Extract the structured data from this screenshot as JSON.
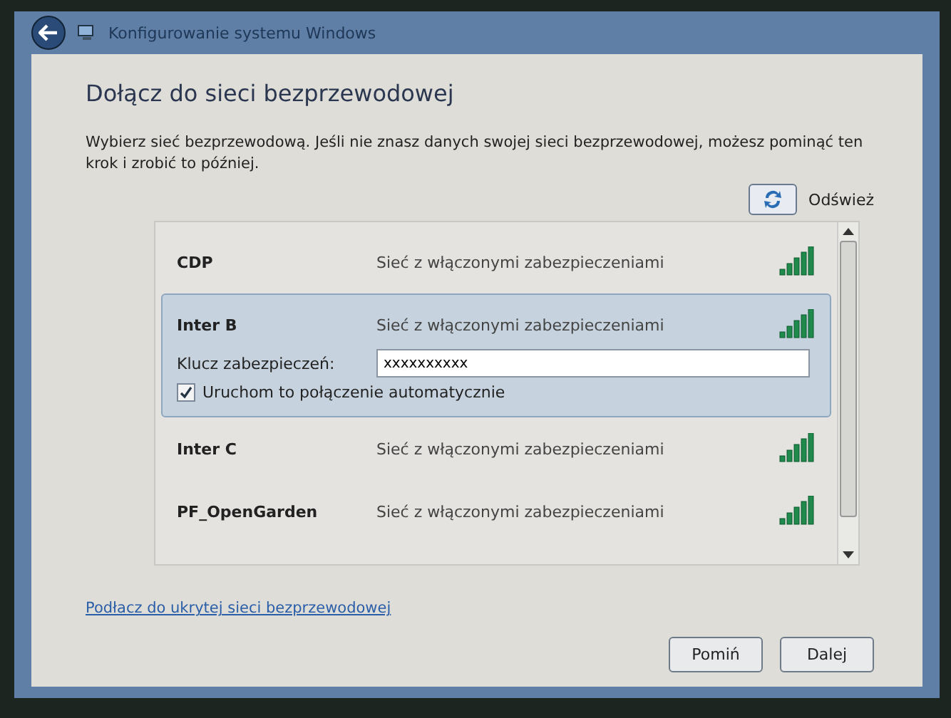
{
  "window": {
    "title": "Konfigurowanie systemu Windows"
  },
  "heading": "Dołącz do sieci bezprzewodowej",
  "description": "Wybierz sieć bezprzewodową. Jeśli nie znasz danych swojej sieci bezprzewodowej, możesz pominąć ten krok i zrobić to później.",
  "refresh_label": "Odśwież",
  "networks": [
    {
      "name": "CDP",
      "status": "Sieć z włączonymi zabezpieczeniami",
      "selected": false
    },
    {
      "name": "Inter B",
      "status": "Sieć z włączonymi zabezpieczeniami",
      "selected": true,
      "key_label": "Klucz zabezpieczeń:",
      "key_value": "xxxxxxxxxx",
      "auto_connect": {
        "label": "Uruchom to połączenie automatycznie",
        "checked": true
      }
    },
    {
      "name": "Inter C",
      "status": "Sieć z włączonymi zabezpieczeniami",
      "selected": false
    },
    {
      "name": "PF_OpenGarden",
      "status": "Sieć z włączonymi zabezpieczeniami",
      "selected": false
    }
  ],
  "hidden_network_link": "Podłacz do ukrytej sieci bezprzewodowej",
  "buttons": [
    "Pomiń",
    "Dalej"
  ]
}
